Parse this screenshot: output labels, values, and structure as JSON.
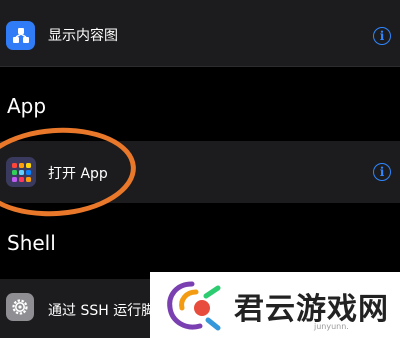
{
  "actions": {
    "show_content": {
      "label": "显示内容图",
      "icon": "shapes-icon",
      "info_glyph": "i"
    },
    "open_app": {
      "label": "打开 App",
      "icon": "app-grid-icon",
      "info_glyph": "i"
    },
    "run_ssh": {
      "label": "通过 SSH 运行脚",
      "icon": "gear-icon"
    }
  },
  "sections": {
    "app": "App",
    "shell": "Shell"
  },
  "watermark": {
    "text": "君云游戏网",
    "subtext": "junyunn."
  },
  "colors": {
    "background": "#000000",
    "row_background": "#1c1c1e",
    "accent_blue": "#2f86ff",
    "highlight_orange": "#e9782a"
  }
}
